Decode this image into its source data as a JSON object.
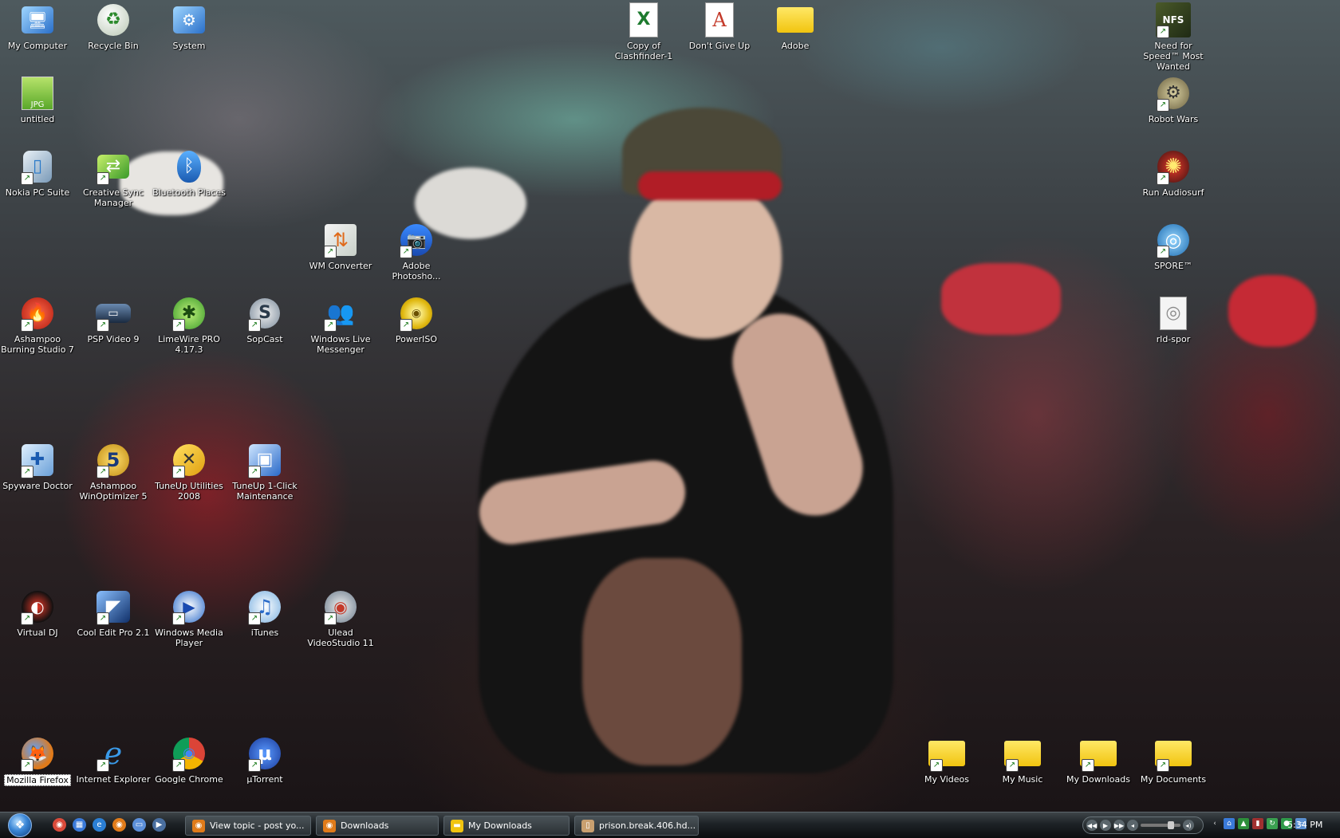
{
  "desktop_icons": [
    {
      "name": "my-computer",
      "label": "My Computer",
      "glyph": "🖥",
      "style": "blue",
      "shortcut": false
    },
    {
      "name": "recycle-bin",
      "label": "Recycle Bin",
      "glyph": "♻",
      "style": "round-light",
      "shortcut": false
    },
    {
      "name": "system",
      "label": "System",
      "glyph": "⚙",
      "style": "blue",
      "shortcut": false
    },
    {
      "name": "copy-of-clashfinder",
      "label": "Copy of Clashfinder-1",
      "glyph": "X",
      "style": "excel",
      "shortcut": false
    },
    {
      "name": "dont-give-up",
      "label": "Don't Give Up",
      "glyph": "A",
      "style": "doc",
      "shortcut": false
    },
    {
      "name": "adobe-folder",
      "label": "Adobe",
      "glyph": "",
      "style": "folder",
      "shortcut": false
    },
    {
      "name": "need-for-speed",
      "label": "Need for Speed™ Most Wanted",
      "glyph": "NFS",
      "style": "nfs",
      "shortcut": true
    },
    {
      "name": "untitled",
      "label": "untitled",
      "glyph": "JPG",
      "style": "jpg",
      "shortcut": false
    },
    {
      "name": "robot-wars",
      "label": "Robot Wars",
      "glyph": "⚙",
      "style": "round-metal",
      "shortcut": true
    },
    {
      "name": "nokia-pc-suite",
      "label": "Nokia PC Suite",
      "glyph": "▯",
      "style": "nokia",
      "shortcut": true
    },
    {
      "name": "creative-sync-manager",
      "label": "Creative Sync Manager",
      "glyph": "⇄",
      "style": "green",
      "shortcut": true
    },
    {
      "name": "bluetooth-places",
      "label": "Bluetooth Places",
      "glyph": "ᛒ",
      "style": "bluetooth",
      "shortcut": false
    },
    {
      "name": "run-audiosurf",
      "label": "Run Audiosurf",
      "glyph": "✺",
      "style": "audiosurf",
      "shortcut": true
    },
    {
      "name": "wm-converter",
      "label": "WM Converter",
      "glyph": "⇅",
      "style": "wm",
      "shortcut": true
    },
    {
      "name": "adobe-photoshop",
      "label": "Adobe Photosho...",
      "glyph": "📷",
      "style": "camera",
      "shortcut": true
    },
    {
      "name": "spore",
      "label": "SPORE™",
      "glyph": "◎",
      "style": "spore",
      "shortcut": true
    },
    {
      "name": "ashampoo-burning-studio",
      "label": "Ashampoo Burning Studio 7",
      "glyph": "🔥",
      "style": "red-round",
      "shortcut": true
    },
    {
      "name": "psp-video",
      "label": "PSP Video 9",
      "glyph": "▭",
      "style": "psp",
      "shortcut": true
    },
    {
      "name": "limewire-pro",
      "label": "LimeWire PRO 4.17.3",
      "glyph": "✱",
      "style": "lime",
      "shortcut": true
    },
    {
      "name": "sopcast",
      "label": "SopCast",
      "glyph": "S",
      "style": "sop",
      "shortcut": true
    },
    {
      "name": "windows-live-messenger",
      "label": "Windows Live Messenger",
      "glyph": "👥",
      "style": "messenger",
      "shortcut": true
    },
    {
      "name": "poweriso",
      "label": "PowerISO",
      "glyph": "◉",
      "style": "gold-disc",
      "shortcut": true
    },
    {
      "name": "rld-spor",
      "label": "rld-spor",
      "glyph": "◎",
      "style": "file-disc",
      "shortcut": false
    },
    {
      "name": "spyware-doctor",
      "label": "Spyware Doctor",
      "glyph": "✚",
      "style": "spyware",
      "shortcut": true
    },
    {
      "name": "ashampoo-winoptimizer",
      "label": "Ashampoo WinOptimizer 5",
      "glyph": "5",
      "style": "winopt",
      "shortcut": true
    },
    {
      "name": "tuneup-utilities",
      "label": "TuneUp Utilities 2008",
      "glyph": "✕",
      "style": "tuneup",
      "shortcut": true
    },
    {
      "name": "tuneup-1-click",
      "label": "TuneUp 1-Click Maintenance",
      "glyph": "▣",
      "style": "tuneup-blue",
      "shortcut": true
    },
    {
      "name": "virtual-dj",
      "label": "Virtual DJ",
      "glyph": "◐",
      "style": "vdj",
      "shortcut": true
    },
    {
      "name": "cool-edit-pro",
      "label": "Cool Edit Pro 2.1",
      "glyph": "◤",
      "style": "cooledit",
      "shortcut": true
    },
    {
      "name": "windows-media-player",
      "label": "Windows Media Player",
      "glyph": "▶",
      "style": "wmp",
      "shortcut": true
    },
    {
      "name": "itunes",
      "label": "iTunes",
      "glyph": "♫",
      "style": "itunes",
      "shortcut": true
    },
    {
      "name": "ulead-videostudio",
      "label": "Ulead VideoStudio 11",
      "glyph": "◉",
      "style": "ulead",
      "shortcut": true
    },
    {
      "name": "mozilla-firefox",
      "label": "Mozilla Firefox",
      "glyph": "🦊",
      "style": "firefox",
      "shortcut": true,
      "selected": true
    },
    {
      "name": "internet-explorer",
      "label": "Internet Explorer",
      "glyph": "e",
      "style": "ie",
      "shortcut": true
    },
    {
      "name": "google-chrome",
      "label": "Google Chrome",
      "glyph": "◉",
      "style": "chrome",
      "shortcut": true
    },
    {
      "name": "utorrent",
      "label": "µTorrent",
      "glyph": "µ",
      "style": "utorrent",
      "shortcut": true
    },
    {
      "name": "my-videos",
      "label": "My Videos",
      "glyph": "",
      "style": "folder",
      "shortcut": true
    },
    {
      "name": "my-music",
      "label": "My Music",
      "glyph": "",
      "style": "folder",
      "shortcut": true
    },
    {
      "name": "my-downloads",
      "label": "My Downloads",
      "glyph": "",
      "style": "folder",
      "shortcut": true
    },
    {
      "name": "my-documents",
      "label": "My Documents",
      "glyph": "",
      "style": "folder",
      "shortcut": true
    }
  ],
  "taskbar": {
    "quick_launch": [
      {
        "name": "chrome-quicklaunch",
        "color": "#d94a3a",
        "glyph": "◉"
      },
      {
        "name": "show-desktop-quicklaunch",
        "color": "#3a7ad9",
        "glyph": "▦"
      },
      {
        "name": "ie-quicklaunch",
        "color": "#2b7fd4",
        "glyph": "e"
      },
      {
        "name": "firefox-quicklaunch",
        "color": "#e07b1a",
        "glyph": "◉"
      },
      {
        "name": "switch-windows-quicklaunch",
        "color": "#5b8fd9",
        "glyph": "▭"
      },
      {
        "name": "media-quicklaunch",
        "color": "#4a6fa0",
        "glyph": "▶"
      }
    ],
    "buttons": [
      {
        "name": "task-view-topic",
        "label": "View topic - post yo...",
        "icon_color": "#e07b1a",
        "glyph": "◉"
      },
      {
        "name": "task-downloads",
        "label": "Downloads",
        "icon_color": "#e07b1a",
        "glyph": "◉"
      },
      {
        "name": "task-my-downloads",
        "label": "My Downloads",
        "icon_color": "#f1c40f",
        "glyph": "▬"
      },
      {
        "name": "task-prison-break",
        "label": "prison.break.406.hd...",
        "icon_color": "#c9a070",
        "glyph": "▯"
      }
    ],
    "clock": "5:34 PM"
  },
  "colors": {
    "taskbar": "#1d2226",
    "folder": "#f1c40f",
    "label_text": "#ffffff"
  }
}
